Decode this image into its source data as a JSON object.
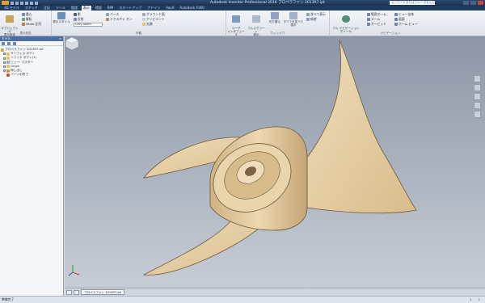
{
  "window": {
    "title": "Autodesk Inventor Professional 2016  プロペラファン 2013R7.ipt",
    "help_placeholder": "キーワードまたはフレーズを入力"
  },
  "tabs": [
    {
      "label": "3D モデル"
    },
    {
      "label": "スケッチ"
    },
    {
      "label": "注記"
    },
    {
      "label": "ツール"
    },
    {
      "label": "管理"
    },
    {
      "label": "表示"
    },
    {
      "label": "環境"
    },
    {
      "label": "BIM"
    },
    {
      "label": "スタートアップ"
    },
    {
      "label": "アドイン"
    },
    {
      "label": "Vault"
    },
    {
      "label": "Autodesk A360"
    }
  ],
  "ribbon": {
    "visibility": {
      "big_label": "オブジェクトの\n表示設定",
      "items": [
        "重心",
        "解析",
        "iMate 記号"
      ],
      "title": "表示設定"
    },
    "appearance": {
      "big_label": "表示スタイル",
      "style_value": "Grey Room",
      "items": [
        "影",
        "反射",
        "テクスチャ オン",
        "パース",
        "グラウンド面",
        "アンビエント",
        "光源"
      ],
      "title": "外観"
    },
    "windows": {
      "user_interface": "ユーザ\nインタフェース",
      "full_screen": "フルスクリーン\n表示",
      "switch": "切り替え",
      "arrange_all": "すべてを並べて表示",
      "side_by_side": "並べて表示",
      "cascade": "重ねて表示",
      "new": "新規",
      "title": "ウィンドウ"
    },
    "navigate": {
      "full_nav_wheel": "フル ナビゲーション\nホイール",
      "items": [
        "範囲ズーム",
        "ズーム",
        "オービット",
        "ビュー全体",
        "画面",
        "ホーム ビュー"
      ],
      "title": "ナビゲーション"
    }
  },
  "browser": {
    "header": "モデル",
    "tree": [
      {
        "label": "プロペラファン 2013R7.ipt",
        "icon": "part-icon",
        "indent": 0
      },
      {
        "label": "サーフェス ボディ",
        "icon": "folder-icon",
        "indent": 1
      },
      {
        "label": "ソリッド ボディ(1)",
        "icon": "folder-icon",
        "indent": 1
      },
      {
        "label": "ビュー: マスター",
        "icon": "view-icon",
        "indent": 1
      },
      {
        "label": "Origin",
        "icon": "folder-icon",
        "indent": 1
      },
      {
        "label": "押し出し",
        "icon": "extrude-icon",
        "indent": 1
      },
      {
        "label": "パーツの終了",
        "icon": "end-of-part-icon",
        "indent": 1
      }
    ]
  },
  "doc_tabs": [
    {
      "label": "プロペラファン 2013R7.ipt"
    }
  ],
  "status": {
    "text": "準備完了",
    "right": [
      "1",
      "1"
    ]
  },
  "colors": {
    "propeller": "#e6cfa5",
    "viewport_top": "#8c96a5",
    "viewport_bottom": "#c6cdd6"
  }
}
